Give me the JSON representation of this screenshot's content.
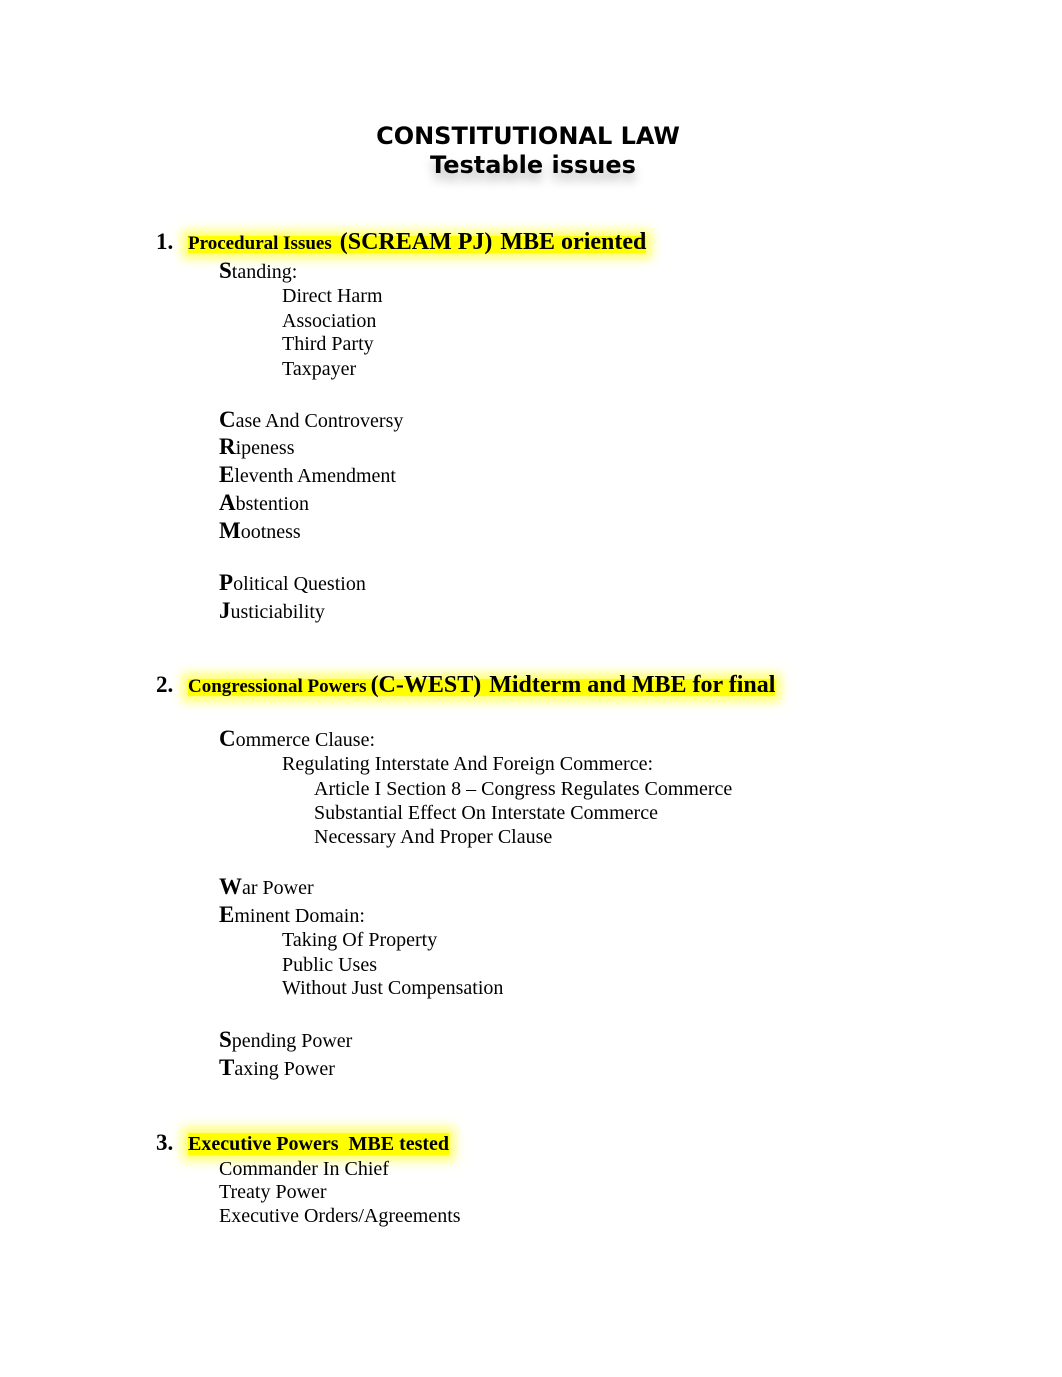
{
  "document": {
    "title": "CONSTITUTIONAL LAW",
    "subtitle": "Testable issues",
    "highlight_color": "#ffff00"
  },
  "sections": [
    {
      "number": "1.",
      "heading": "Procedural Issues",
      "acronym": "(SCREAM PJ)",
      "note": "MBE oriented",
      "items": {
        "standing": {
          "cap": "S",
          "rest": "tanding:"
        },
        "standing_subs": [
          "Direct Harm",
          "Association",
          "Third Party",
          "Taxpayer"
        ],
        "case": {
          "cap": "C",
          "rest": "ase And Controversy"
        },
        "ripeness": {
          "cap": "R",
          "rest": "ipeness"
        },
        "eleventh": {
          "cap": "E",
          "rest": "leventh Amendment"
        },
        "abstention": {
          "cap": "A",
          "rest": "bstention"
        },
        "mootness": {
          "cap": "M",
          "rest": "ootness"
        },
        "political": {
          "cap": "P",
          "rest": "olitical Question"
        },
        "justiciability": {
          "cap": "J",
          "rest": "usticiability"
        }
      }
    },
    {
      "number": "2.",
      "heading": "Congressional Powers",
      "acronym": "(C-WEST)",
      "note": "Midterm and MBE for final",
      "items": {
        "commerce": {
          "cap": "C",
          "rest": "ommerce Clause:"
        },
        "commerce_sub": "Regulating Interstate And Foreign Commerce:",
        "commerce_subsubs": [
          "Article I Section 8 – Congress Regulates Commerce",
          "Substantial Effect On Interstate Commerce",
          "Necessary And Proper Clause"
        ],
        "war": {
          "cap": "W",
          "rest": "ar Power"
        },
        "eminent": {
          "cap": "E",
          "rest": "minent Domain:"
        },
        "eminent_subs": [
          "Taking Of Property",
          "Public Uses",
          "Without Just Compensation"
        ],
        "spending": {
          "cap": "S",
          "rest": "pending Power"
        },
        "taxing": {
          "cap": "T",
          "rest": "axing Power"
        }
      }
    },
    {
      "number": "3.",
      "heading": "Executive Powers",
      "note": "MBE tested",
      "items": [
        "Commander In Chief",
        "Treaty Power",
        "Executive Orders/Agreements"
      ]
    }
  ]
}
